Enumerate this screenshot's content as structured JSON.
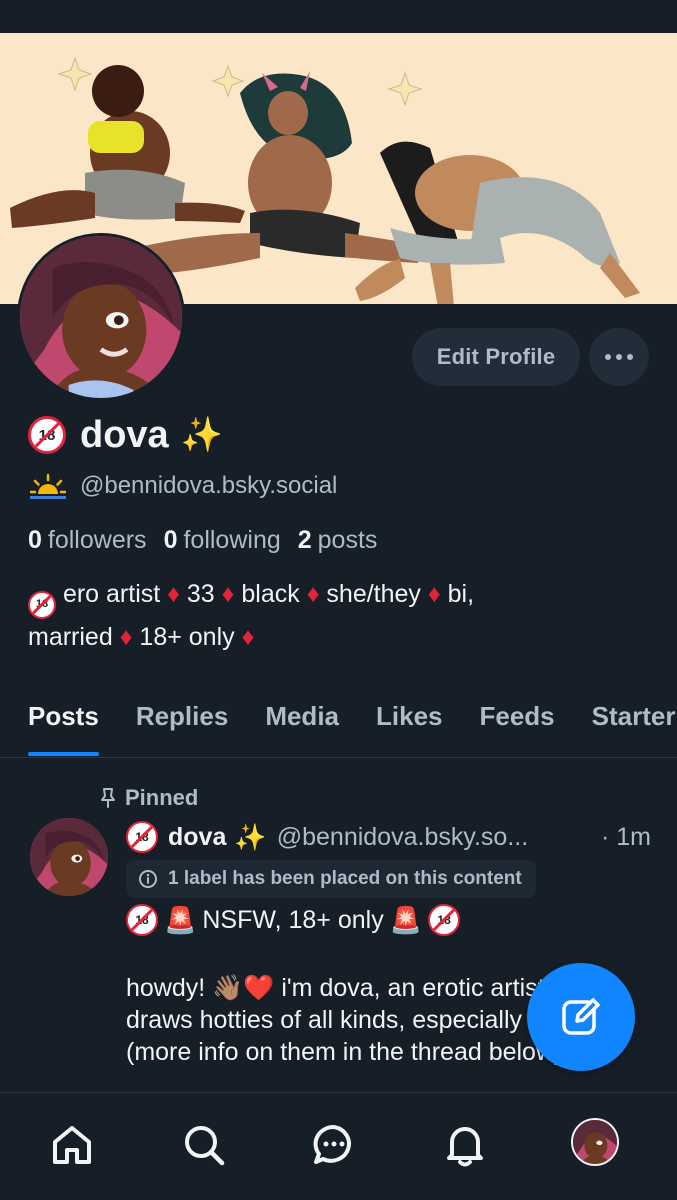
{
  "banner": {
    "description_icon": "artwork-banner"
  },
  "profile": {
    "display_name": "dova",
    "handle": "@bennidova.bsky.social",
    "edit_button": "Edit Profile",
    "stats": {
      "followers_count": "0",
      "followers_label": "followers",
      "following_count": "0",
      "following_label": "following",
      "posts_count": "2",
      "posts_label": "posts"
    },
    "bio": {
      "line1_items": [
        "ero artist",
        "33",
        "black",
        "she/they",
        "bi,"
      ],
      "line2_items": [
        "married",
        "18+ only"
      ]
    }
  },
  "tabs": [
    "Posts",
    "Replies",
    "Media",
    "Likes",
    "Feeds",
    "Starter Packs"
  ],
  "active_tab": "Posts",
  "post": {
    "pinned_label": "Pinned",
    "author_name": "dova",
    "author_handle": "@bennidova.bsky.so...",
    "time_prefix": "·",
    "time": "1m",
    "label_notice": "1 label has been placed on this content",
    "line1_text": "NSFW, 18+ only",
    "body_text": "howdy! 👋🏽❤️ i'm dova, an erotic artist that draws hotties of all kinds, especially my OCs (more info on them in the thread below)!"
  },
  "colors": {
    "accent": "#1185fe",
    "background": "#161e27",
    "muted": "#aebbc9",
    "diamond": "#e0243a"
  },
  "icons": [
    "home-icon",
    "search-icon",
    "chat-icon",
    "bell-icon",
    "compose-icon",
    "pin-icon",
    "info-icon",
    "sunrise-icon",
    "sparkles-icon",
    "no-under-18-icon",
    "siren-icon",
    "diamond-icon"
  ]
}
